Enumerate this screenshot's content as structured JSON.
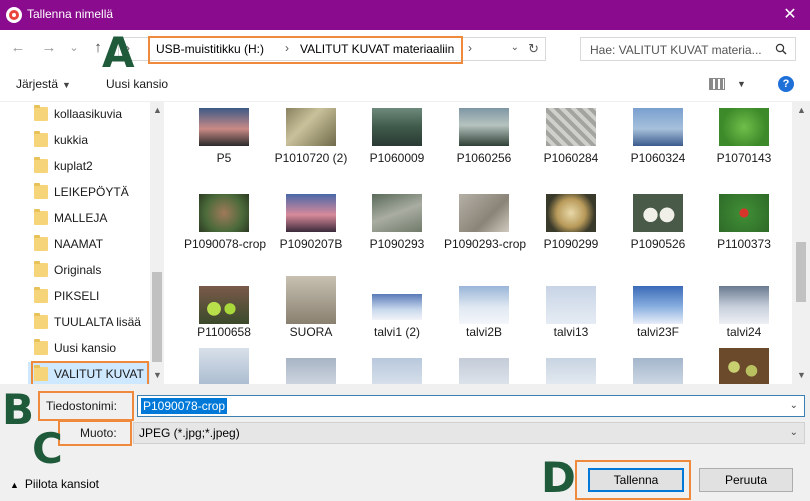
{
  "window": {
    "title": "Tallenna nimellä",
    "close_glyph": "✕",
    "title_bar_color": "#8b0b8e"
  },
  "nav": {
    "back_glyph": "←",
    "forward_glyph": "→",
    "recent_glyph": "⌄",
    "up_glyph": "↑",
    "address": {
      "segment_1": "USB-muistitikku (H:)",
      "segment_2": "VALITUT KUVAT materiaaliin",
      "separator": "›",
      "dropdown_glyph": "⌄",
      "refresh_glyph": "↻"
    },
    "search_placeholder": "Hae: VALITUT KUVAT materia..."
  },
  "toolbar": {
    "organize_label": "Järjestä",
    "organize_caret": "▼",
    "new_folder_label": "Uusi kansio",
    "view_caret": "▼",
    "help_glyph": "?"
  },
  "sidebar": {
    "items": [
      {
        "label": "kollaasikuvia"
      },
      {
        "label": "kukkia"
      },
      {
        "label": "kuplat2"
      },
      {
        "label": "LEIKEPÖYTÄ"
      },
      {
        "label": "MALLEJA"
      },
      {
        "label": "NAAMAT"
      },
      {
        "label": "Originals"
      },
      {
        "label": "PIKSELI"
      },
      {
        "label": "TUULALTA lisää"
      },
      {
        "label": "Uusi kansio"
      },
      {
        "label": "VALITUT KUVAT"
      }
    ],
    "scroll_up_glyph": "▲",
    "scroll_down_glyph": "▼"
  },
  "files": {
    "rows": [
      [
        "P5",
        "P1010720 (2)",
        "P1060009",
        "P1060256",
        "P1060284",
        "P1060324",
        "P1070143"
      ],
      [
        "P1090078-crop",
        "P1090207B",
        "P1090293",
        "P1090293-crop",
        "P1090299",
        "P1090526",
        "P1100373"
      ],
      [
        "P1100658",
        "SUORA",
        "talvi1 (2)",
        "talvi2B",
        "talvi13",
        "talvi23F",
        "talvi24"
      ],
      [
        "",
        "",
        "",
        "",
        "",
        "",
        ""
      ]
    ],
    "scroll_up_glyph": "▲",
    "scroll_down_glyph": "▼"
  },
  "form": {
    "filename_label": "Tiedostonimi:",
    "filename_value": "P1090078-crop",
    "filetype_label": "Muoto:",
    "filetype_value": "JPEG (*.jpg;*.jpeg)",
    "dropdown_glyph": "⌄"
  },
  "footer": {
    "hide_folders_label": "Piilota kansiot",
    "hide_folders_glyph": "▲",
    "save_label": "Tallenna",
    "cancel_label": "Peruuta"
  },
  "callouts": {
    "a": "A",
    "b": "B",
    "c": "C",
    "d": "D"
  },
  "colors": {
    "highlight_box": "#ef8a3c",
    "callout_letter": "#1f5a3a",
    "selection": "#0078d7"
  }
}
